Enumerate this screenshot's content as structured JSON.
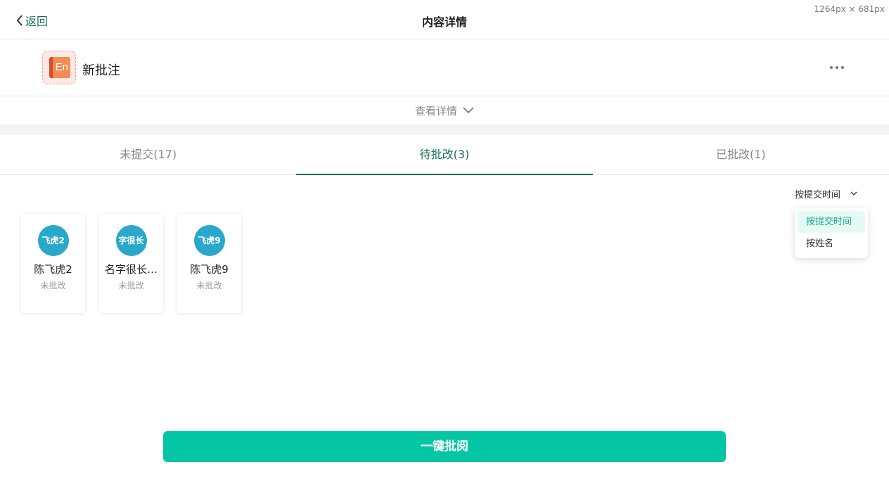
{
  "header": {
    "back_label": "返回",
    "title": "内容详情",
    "dimensions_label": "1264px × 681px"
  },
  "content": {
    "icon_text": "En",
    "name": "新批注"
  },
  "details_toggle": {
    "label": "查看详情"
  },
  "tabs": [
    {
      "label": "未提交(17)",
      "active": false
    },
    {
      "label": "待批改(3)",
      "active": true
    },
    {
      "label": "已批改(1)",
      "active": false
    }
  ],
  "sort": {
    "current": "按提交时间",
    "options": [
      {
        "label": "按提交时间",
        "selected": true
      },
      {
        "label": "按姓名",
        "selected": false
      }
    ]
  },
  "students": [
    {
      "avatar_text": "飞虎2",
      "name": "陈飞虎2",
      "status": "未批改"
    },
    {
      "avatar_text": "字很长",
      "name": "名字很长…",
      "status": "未批改"
    },
    {
      "avatar_text": "飞虎9",
      "name": "陈飞虎9",
      "status": "未批改"
    }
  ],
  "batch_button": {
    "label": "一键批阅"
  },
  "colors": {
    "accent": "#1a6e5c",
    "button": "#04c6a4",
    "avatar": "#2aa8cc"
  }
}
